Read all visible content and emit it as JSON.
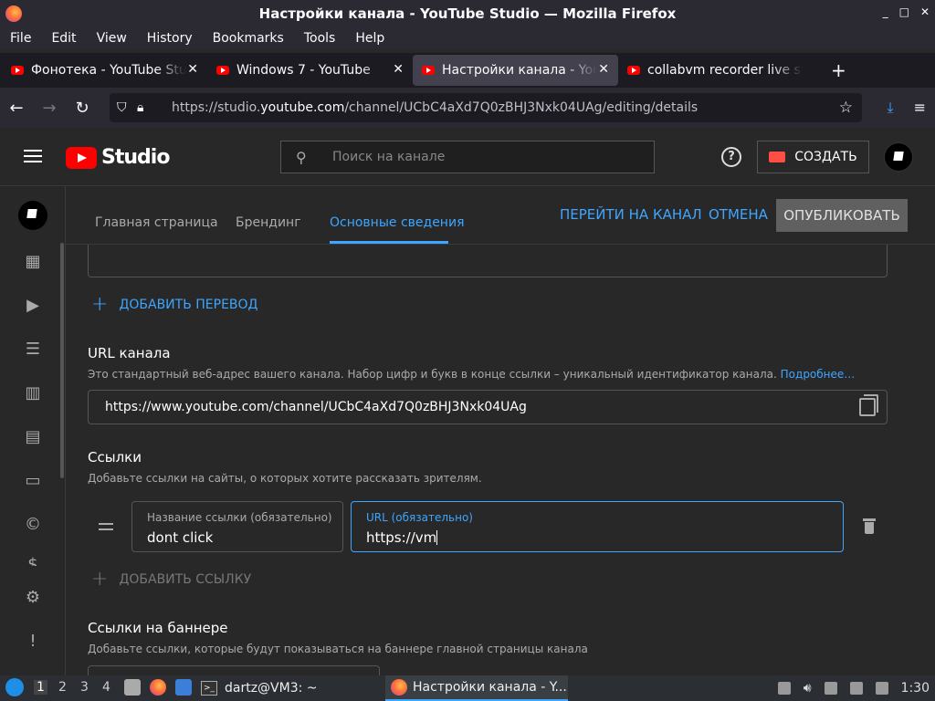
{
  "window": {
    "title": "Настройки канала - YouTube Studio — Mozilla Firefox",
    "controls": [
      "_",
      "□",
      "✕"
    ]
  },
  "menubar": [
    "File",
    "Edit",
    "View",
    "History",
    "Bookmarks",
    "Tools",
    "Help"
  ],
  "tabs": [
    {
      "title": "Фонотека - YouTube Studio",
      "active": false
    },
    {
      "title": "Windows 7 - YouTube",
      "active": false
    },
    {
      "title": "Настройки канала - YouTube Studio",
      "active": true
    },
    {
      "title": "collabvm recorder live stream",
      "active": false
    }
  ],
  "address": {
    "prefix": "https://studio.",
    "domain": "youtube.com",
    "path": "/channel/UCbC4aXd7Q0zBHJ3Nxk04UAg/editing/details"
  },
  "studio_header": {
    "logo_text": "Studio",
    "search_placeholder": "Поиск на канале",
    "create_label": "СОЗДАТЬ",
    "help_glyph": "?"
  },
  "sidebar_icons": [
    "dashboard-icon",
    "content-icon",
    "playlists-icon",
    "analytics-icon",
    "comments-icon",
    "subtitles-icon",
    "copyright-icon",
    "monetization-icon",
    "settings-icon",
    "feedback-icon"
  ],
  "customization_tabs": {
    "home": "Главная страница",
    "branding": "Брендинг",
    "basic_info": "Основные сведения"
  },
  "actions": {
    "view_channel": "ПЕРЕЙТИ НА КАНАЛ",
    "cancel": "ОТМЕНА",
    "publish": "ОПУБЛИКОВАТЬ"
  },
  "add_translation": "ДОБАВИТЬ ПЕРЕВОД",
  "channel_url": {
    "title": "URL канала",
    "description": "Это стандартный веб-адрес вашего канала. Набор цифр и букв в конце ссылки – уникальный идентификатор канала.",
    "more": "Подробнее…",
    "value": "https://www.youtube.com/channel/UCbC4aXd7Q0zBHJ3Nxk04UAg"
  },
  "links": {
    "title": "Ссылки",
    "description": "Добавьте ссылки на сайты, о которых хотите рассказать зрителям.",
    "name_label": "Название ссылки (обязательно)",
    "name_value": "dont click",
    "url_label": "URL (обязательно)",
    "url_value": "https://vm",
    "add_link": "ДОБАВИТЬ ССЫЛКУ"
  },
  "banner_links": {
    "title": "Ссылки на баннере",
    "description": "Добавьте ссылки, которые будут показываться на баннере главной страницы канала"
  },
  "taskbar": {
    "workspaces": [
      "1",
      "2",
      "3",
      "4"
    ],
    "terminal": "dartz@VM3: ~",
    "firefox": "Настройки канала - Y...",
    "clock": "1:30"
  },
  "colors": {
    "accent": "#3ea6ff",
    "youtube_red": "#ff0000",
    "background": "#282828"
  }
}
